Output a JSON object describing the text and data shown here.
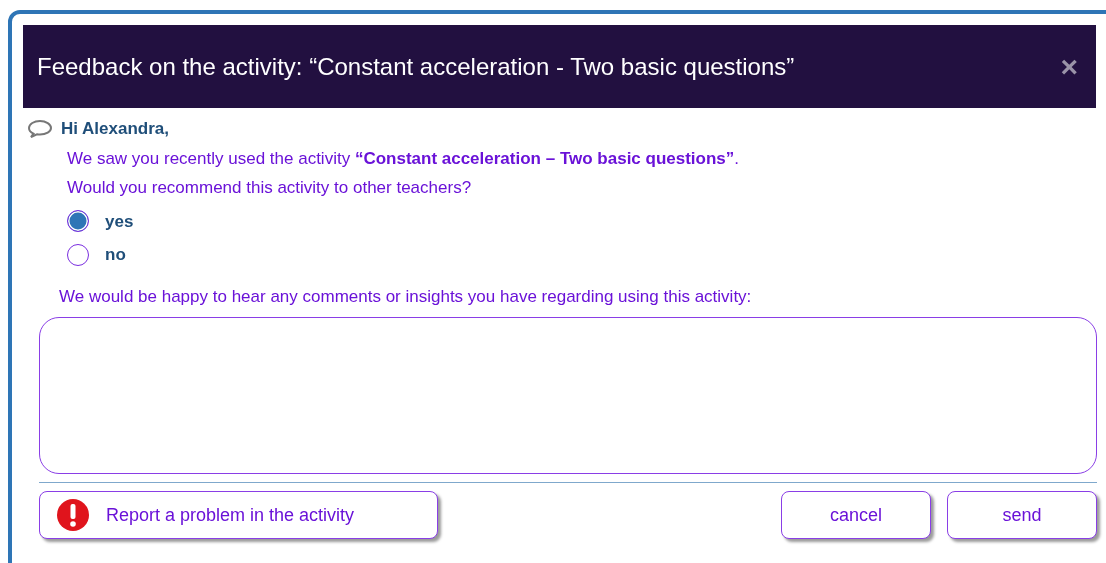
{
  "dialog": {
    "title": "Feedback on the activity: “Constant acceleration - Two basic questions”",
    "close": "×"
  },
  "greeting": "Hi Alexandra,",
  "message": "We saw you recently used the activity **“Constant acceleration – Two basic questions”**.",
  "question": "Would you recommend this activity to other teachers?",
  "options": [
    {
      "label": "yes",
      "selected": true
    },
    {
      "label": "no",
      "selected": false
    }
  ],
  "comments": {
    "label": "We would be happy to hear any comments or insights you have regarding using this activity:"
  },
  "buttons": [
    {
      "label": "Report a problem in the activity",
      "kind": "report"
    },
    {
      "label": "cancel",
      "kind": "plain"
    },
    {
      "label": "send",
      "kind": "plain"
    }
  ]
}
